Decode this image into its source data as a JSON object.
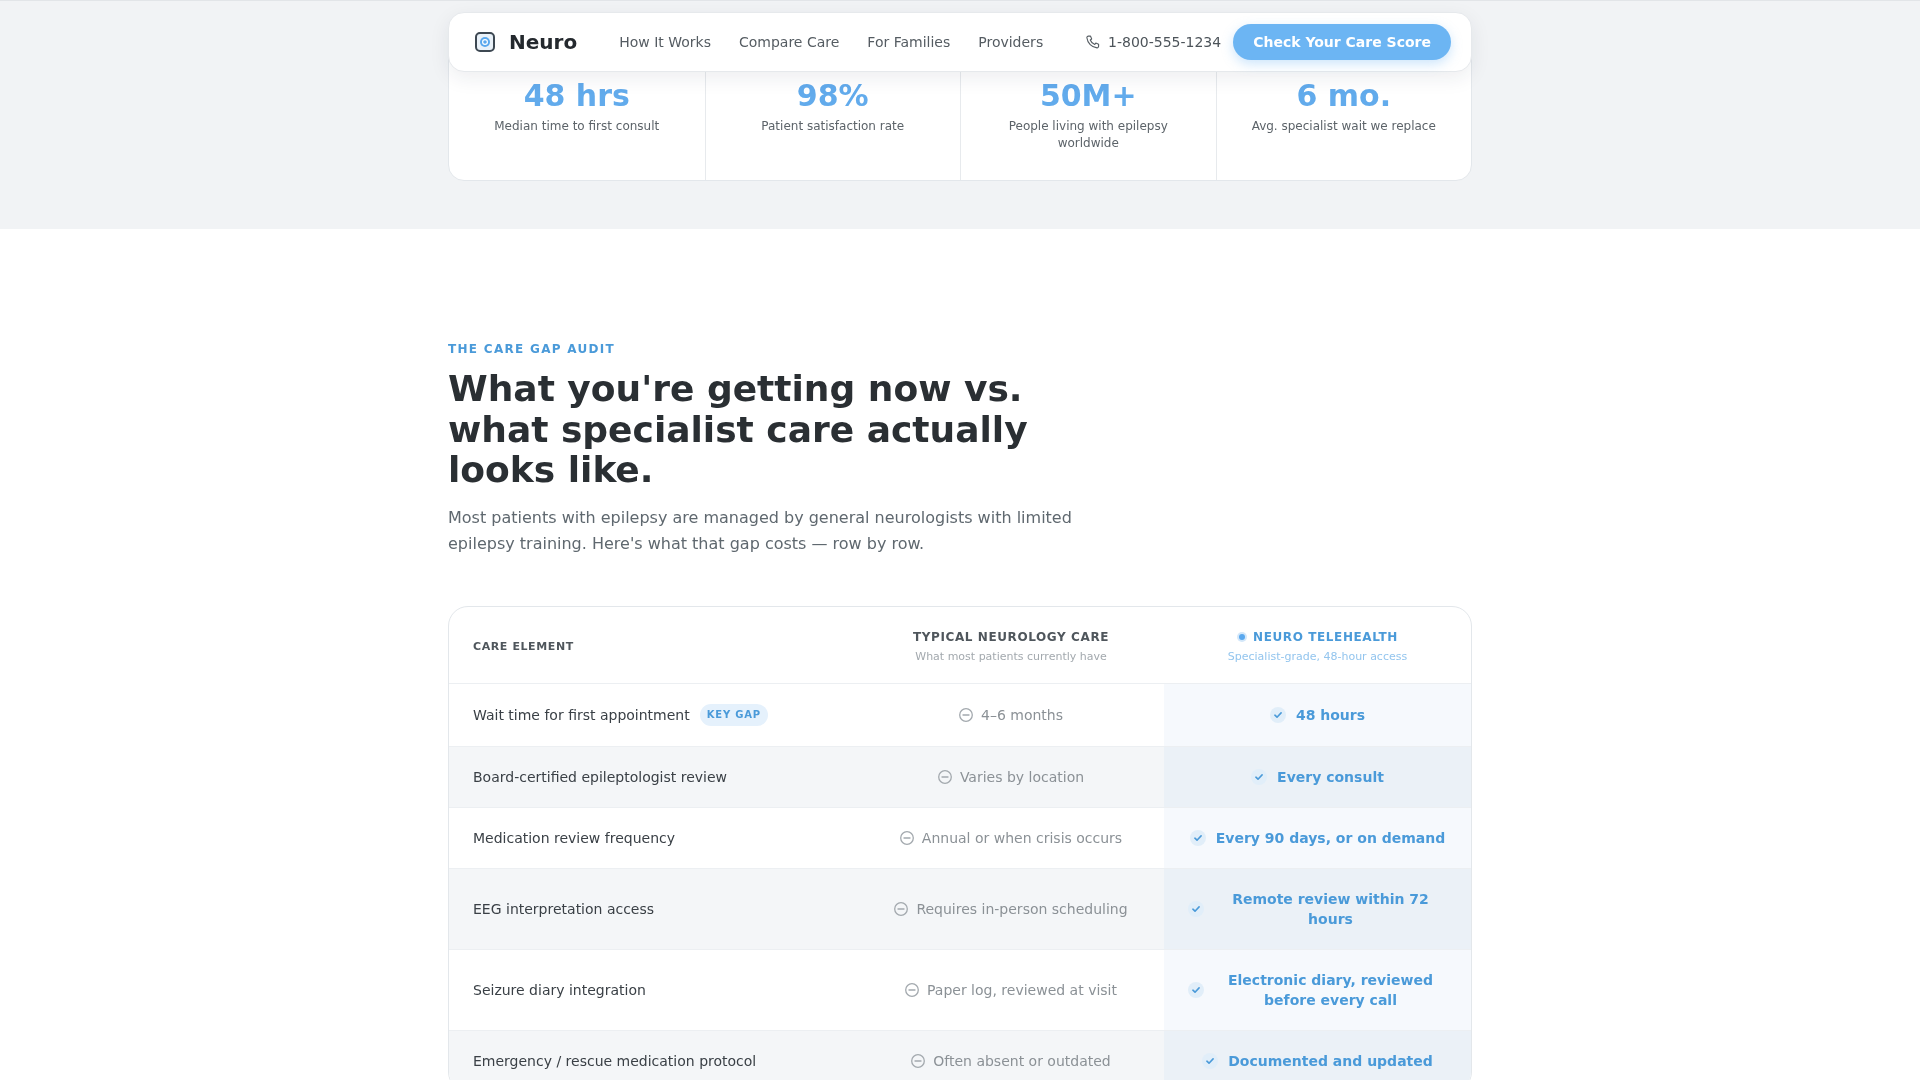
{
  "nav": {
    "brand": "Neuro",
    "links": [
      "How It Works",
      "Compare Care",
      "For Families",
      "Providers"
    ],
    "phone": "1-800-555-1234",
    "cta": "Check Your Care Score"
  },
  "stats": [
    {
      "value": "48 hrs",
      "label": "Median time to first consult"
    },
    {
      "value": "98%",
      "label": "Patient satisfaction rate"
    },
    {
      "value": "50M+",
      "label": "People living with epilepsy worldwide"
    },
    {
      "value": "6 mo.",
      "label": "Avg. specialist wait we replace"
    }
  ],
  "section": {
    "eyebrow": "THE CARE GAP AUDIT",
    "heading": "What you're getting now vs. what specialist care actually looks like.",
    "intro": "Most patients with epilepsy are managed by general neurologists with limited epilepsy training. Here's what that gap costs — row by row."
  },
  "table": {
    "columns": [
      {
        "kind": "element",
        "title": "CARE ELEMENT"
      },
      {
        "kind": "typical",
        "title": "TYPICAL NEUROLOGY CARE",
        "subtitle": "What most patients currently have"
      },
      {
        "kind": "telehealth",
        "title": "NEURO TELEHEALTH",
        "subtitle": "Specialist-grade, 48-hour access"
      }
    ],
    "rows": [
      {
        "element": "Wait time for first appointment",
        "badge": "KEY GAP",
        "typical": "4–6 months",
        "telehealth": "48 hours"
      },
      {
        "element": "Board-certified epileptologist review",
        "typical": "Varies by location",
        "telehealth": "Every consult"
      },
      {
        "element": "Medication review frequency",
        "typical": "Annual or when crisis occurs",
        "telehealth": "Every 90 days, or on demand"
      },
      {
        "element": "EEG interpretation access",
        "typical": "Requires in-person scheduling",
        "telehealth": "Remote review within 72 hours"
      },
      {
        "element": "Seizure diary integration",
        "typical": "Paper log, reviewed at visit",
        "telehealth": "Electronic diary, reviewed before every call"
      },
      {
        "element": "Emergency / rescue medication protocol",
        "typical": "Often absent or outdated",
        "telehealth": "Documented and updated"
      }
    ]
  }
}
